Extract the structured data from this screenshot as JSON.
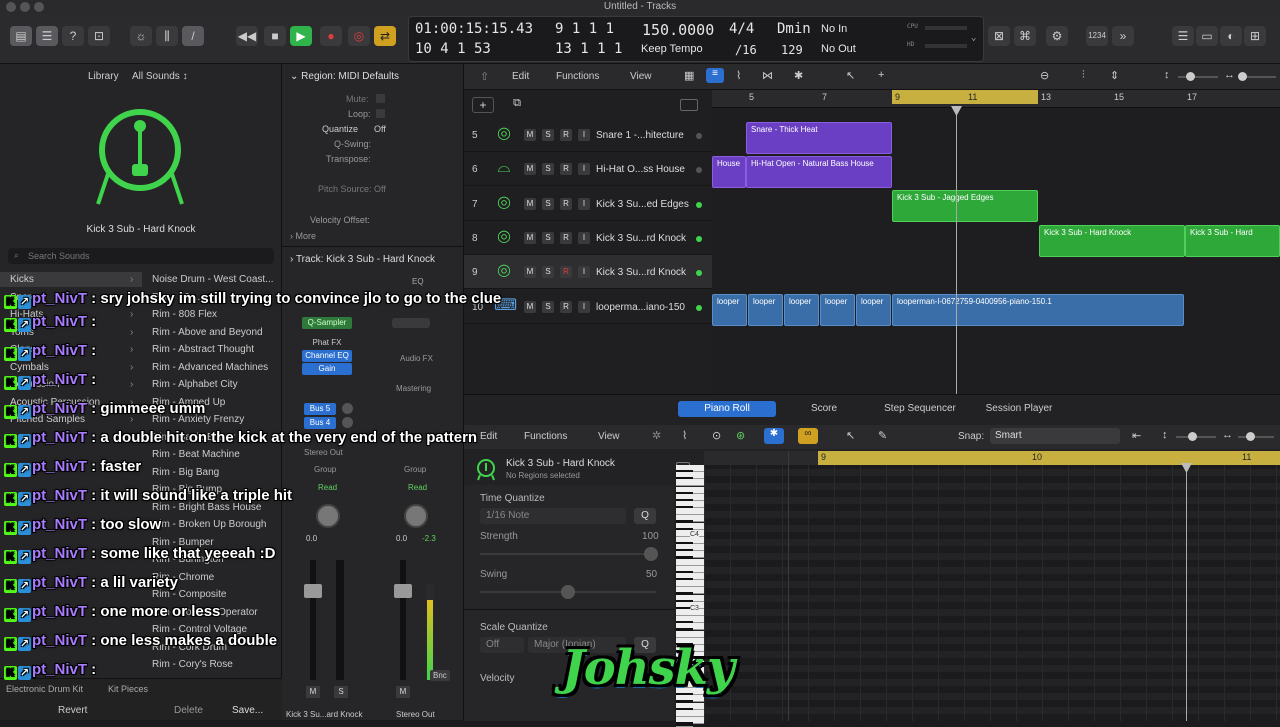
{
  "window": {
    "title": "Untitled - Tracks"
  },
  "lcd": {
    "time_top": "01:00:15:15.43",
    "time_bottom": "10 4 1  53",
    "bars_top": "9  1  1     1",
    "bars_bottom": "13  1  1     1",
    "tempo": "150.0000",
    "tempo_mode": "Keep Tempo",
    "sig_top": "4/4",
    "sig_bottom": "/16",
    "key": "Dmin",
    "key_num": "129",
    "midi_in": "No In",
    "midi_out": "No Out",
    "cpu": "CPU",
    "hd": "HD",
    "count": "1234"
  },
  "library": {
    "title": "Library",
    "filter": "All Sounds ↕",
    "patch_name": "Kick 3 Sub - Hard Knock",
    "search_placeholder": "Search Sounds",
    "categories": [
      "Kicks",
      "Snares",
      "Hi-Hats",
      "Toms",
      "Claps",
      "Cymbals",
      "Percussion",
      "Acoustic Percussion",
      "Pitched Samples"
    ],
    "items": [
      "Noise Drum - West Coast...",
      "Rim - 80s...",
      "Rim - 808 Flex",
      "Rim - Above and Beyond",
      "Rim - Abstract Thought",
      "Rim - Advanced Machines",
      "Rim - Alphabet City",
      "Rim - Amped Up",
      "Rim - Anxiety Frenzy",
      "Rim - Battle Blazer",
      "Rim - Beat Machine",
      "Rim - Big Bang",
      "Rim - Big Bump",
      "Rim - Bright Bass House",
      "Rim - Broken Up Borough",
      "Rim - Bumper",
      "Rim - Burlington",
      "Rim - Chrome",
      "Rim - Composite",
      "Rim - Console Operator",
      "Rim - Control Voltage",
      "Rim - Cork Drum",
      "Rim - Cory's Rose"
    ],
    "footer_left": "Electronic Drum Kit",
    "footer_mid": "Kit Pieces",
    "revert": "Revert",
    "delete": "Delete",
    "save": "Save..."
  },
  "inspector": {
    "region_title": "Region: MIDI Defaults",
    "mute": "Mute:",
    "loop": "Loop:",
    "quantize": "Quantize",
    "quantize_val": "Off",
    "qswing": "Q-Swing:",
    "transpose": "Transpose:",
    "pitch_source": "Pitch Source:",
    "pitch_source_val": "Off",
    "velocity_offset": "Velocity Offset:",
    "more": "More",
    "track_title": "Track:  Kick 3 Sub - Hard Knock",
    "eq": "EQ",
    "qsampler": "Q-Sampler",
    "phat": "Phat FX",
    "chan_eq": "Channel EQ",
    "gain": "Gain",
    "audio_fx": "Audio FX",
    "mastering": "Mastering",
    "bus5": "Bus 5",
    "bus4": "Bus 4",
    "stereo_out": "Stereo Out",
    "group": "Group",
    "read": "Read",
    "val_a": "0.0",
    "val_b": "0.0",
    "val_c": "-2.3",
    "m": "M",
    "s": "S",
    "bnc": "Bnc",
    "strip1": "Kick 3 Su...ard Knock",
    "strip2": "Stereo Out"
  },
  "tracks_toolbar": {
    "edit": "Edit",
    "functions": "Functions",
    "view": "View"
  },
  "ruler": [
    "5",
    "7",
    "9",
    "11",
    "13",
    "15",
    "17"
  ],
  "tracks": [
    {
      "num": "5",
      "name": "Snare 1 -...hitecture"
    },
    {
      "num": "6",
      "name": "Hi-Hat O...ss House"
    },
    {
      "num": "7",
      "name": "Kick 3 Su...ed Edges"
    },
    {
      "num": "8",
      "name": "Kick 3 Su...rd Knock"
    },
    {
      "num": "9",
      "name": "Kick 3 Su...rd Knock"
    },
    {
      "num": "10",
      "name": "looperma...iano-150"
    }
  ],
  "regions": {
    "snare": "Snare - Thick Heat",
    "hh_a": "House",
    "hh_b": "Hi-Hat Open - Natural Bass House",
    "kick_jag": "Kick 3 Sub - Jagged Edges",
    "kick_hard1": "Kick 3 Sub - Hard Knock",
    "kick_hard2": "Kick 3 Sub - Hard",
    "looper": "looper",
    "looper_long": "looperman-l-0672759-0400956-piano-150.1"
  },
  "pianoroll": {
    "tabs": [
      "Piano Roll",
      "Score",
      "Step Sequencer",
      "Session Player"
    ],
    "edit": "Edit",
    "functions": "Functions",
    "view": "View",
    "snap_label": "Snap:",
    "snap_val": "Smart",
    "track_name": "Kick 3 Sub - Hard Knock",
    "no_regions": "No Regions selected",
    "time_quantize": "Time Quantize",
    "note_val": "1/16 Note",
    "q": "Q",
    "strength": "Strength",
    "strength_val": "100",
    "swing": "Swing",
    "swing_val": "50",
    "scale_quantize": "Scale Quantize",
    "scale_off": "Off",
    "scale_major": "Major (Ionian)",
    "velocity": "Velocity",
    "ruler": [
      "9",
      "10",
      "11"
    ],
    "c4": "C4",
    "c3": "C3"
  },
  "chat": {
    "username": "pt_NivT",
    "messages": [
      "sry johsky im still trying to convince jlo to go to the clue",
      "",
      "",
      "",
      "gimmeee umm",
      "a double hit on the kick at the very end of the pattern",
      "faster",
      "it will sound like a triple hit",
      "too slow",
      "some like that yeeeah :D",
      "a lil variety",
      "one more or less",
      "one less makes a double",
      ""
    ]
  },
  "watermark": "Johsky",
  "colors": {
    "accent_blue": "#2b6fd1",
    "region_purple": "#6a3fc4",
    "region_green": "#2fa83a",
    "region_blue": "#3a6ea8",
    "play_green": "#2fb34a",
    "chat_user": "#a97cff"
  }
}
